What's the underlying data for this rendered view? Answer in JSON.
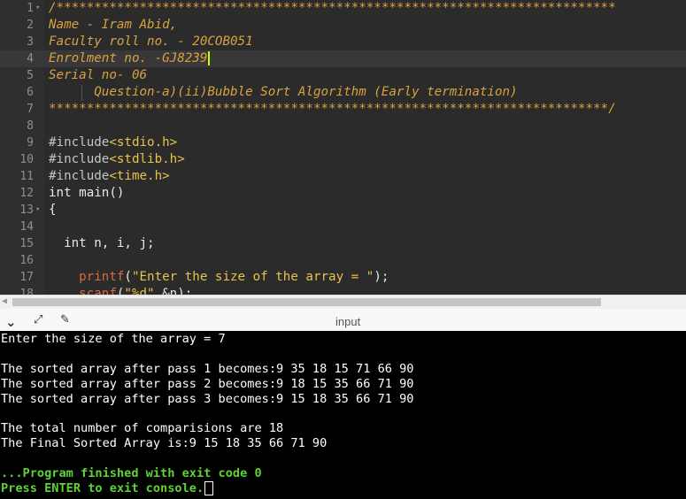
{
  "editor": {
    "lines": [
      {
        "num": "1",
        "fold": true,
        "segments": [
          {
            "cls": "cm",
            "text": "/**************************************************************************"
          }
        ]
      },
      {
        "num": "2",
        "segments": [
          {
            "cls": "cm",
            "text": "Name - Iram Abid,"
          }
        ]
      },
      {
        "num": "3",
        "segments": [
          {
            "cls": "cm",
            "text": "Faculty roll no. - 20COB051"
          }
        ]
      },
      {
        "num": "4",
        "active": true,
        "cursor": true,
        "segments": [
          {
            "cls": "cm",
            "text": "Enrolment no. -GJ8239"
          }
        ]
      },
      {
        "num": "5",
        "segments": [
          {
            "cls": "cm",
            "text": "Serial no- 06"
          }
        ]
      },
      {
        "num": "6",
        "segments": [
          {
            "cls": "cm",
            "text": "      Question-a)(ii)Bubble Sort Algorithm (Early termination)"
          }
        ]
      },
      {
        "num": "7",
        "segments": [
          {
            "cls": "cm",
            "text": "**************************************************************************/"
          }
        ]
      },
      {
        "num": "8",
        "segments": []
      },
      {
        "num": "9",
        "segments": [
          {
            "cls": "pre",
            "text": "#include"
          },
          {
            "cls": "str",
            "text": "<stdio.h>"
          }
        ]
      },
      {
        "num": "10",
        "segments": [
          {
            "cls": "pre",
            "text": "#include"
          },
          {
            "cls": "str",
            "text": "<stdlib.h>"
          }
        ]
      },
      {
        "num": "11",
        "segments": [
          {
            "cls": "pre",
            "text": "#include"
          },
          {
            "cls": "str",
            "text": "<time.h>"
          }
        ]
      },
      {
        "num": "12",
        "segments": [
          {
            "cls": "kw",
            "text": "int main()"
          }
        ]
      },
      {
        "num": "13",
        "fold": true,
        "segments": [
          {
            "cls": "plain",
            "text": "{"
          }
        ]
      },
      {
        "num": "14",
        "segments": []
      },
      {
        "num": "15",
        "segments": [
          {
            "cls": "kw",
            "text": "  int n, i, j;"
          }
        ]
      },
      {
        "num": "16",
        "segments": []
      },
      {
        "num": "17",
        "segments": [
          {
            "cls": "fn",
            "text": "    printf"
          },
          {
            "cls": "plain",
            "text": "("
          },
          {
            "cls": "str",
            "text": "\"Enter the size of the array = \""
          },
          {
            "cls": "plain",
            "text": ");"
          }
        ]
      },
      {
        "num": "18",
        "segments": [
          {
            "cls": "fn",
            "text": "    scanf"
          },
          {
            "cls": "plain",
            "text": "("
          },
          {
            "cls": "str",
            "text": "\"%d\""
          },
          {
            "cls": "plain",
            "text": ",&n);"
          }
        ]
      }
    ]
  },
  "toolbar": {
    "input_label": "input",
    "collapse_icon": "chevron-down-icon",
    "expand_icon": "expand-icon",
    "clear_icon": "broom-icon"
  },
  "console": {
    "lines": [
      {
        "text": "Enter the size of the array = 7",
        "green": false
      },
      {
        "text": "",
        "green": false
      },
      {
        "text": "The sorted array after pass 1 becomes:9 35 18 15 71 66 90",
        "green": false
      },
      {
        "text": "The sorted array after pass 2 becomes:9 18 15 35 66 71 90",
        "green": false
      },
      {
        "text": "The sorted array after pass 3 becomes:9 15 18 35 66 71 90",
        "green": false
      },
      {
        "text": "",
        "green": false
      },
      {
        "text": "The total number of comparisions are 18",
        "green": false
      },
      {
        "text": "The Final Sorted Array is:9 15 18 35 66 71 90",
        "green": false
      },
      {
        "text": "",
        "green": false
      },
      {
        "text": "...Program finished with exit code 0",
        "green": true
      },
      {
        "text": "Press ENTER to exit console.",
        "green": true,
        "cursor": true
      }
    ]
  },
  "colors": {
    "editor_bg": "#2b2b2b",
    "comment": "#d9a241",
    "string": "#e8c34a",
    "function": "#d96b40",
    "console_bg": "#000000",
    "console_green": "#5ed238"
  }
}
